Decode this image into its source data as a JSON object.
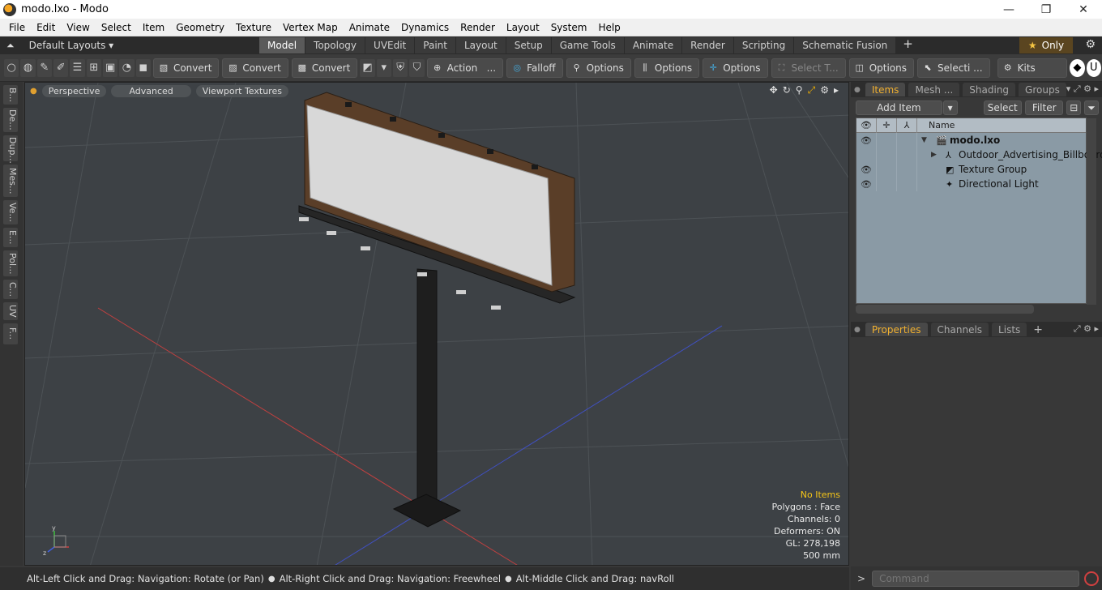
{
  "window": {
    "title": "modo.lxo - Modo",
    "minimize": "—",
    "maximize": "❐",
    "close": "✕"
  },
  "menu": [
    "File",
    "Edit",
    "View",
    "Select",
    "Item",
    "Geometry",
    "Texture",
    "Vertex Map",
    "Animate",
    "Dynamics",
    "Render",
    "Layout",
    "System",
    "Help"
  ],
  "layouts": {
    "selector": "Default Layouts ▾",
    "tabs": [
      "Model",
      "Topology",
      "UVEdit",
      "Paint",
      "Layout",
      "Setup",
      "Game Tools",
      "Animate",
      "Render",
      "Scripting",
      "Schematic Fusion"
    ],
    "active": "Model",
    "add": "+",
    "only": "Only"
  },
  "toolbar": {
    "convert1": "Convert",
    "convert2": "Convert",
    "convert3": "Convert",
    "action": "Action",
    "action_more": "...",
    "falloff": "Falloff",
    "options1": "Options",
    "options2": "Options",
    "options3": "Options",
    "select_t": "Select T...",
    "options4": "Options",
    "selecti": "Selecti ...",
    "kits": "Kits"
  },
  "left_tabs": [
    "B...",
    "De...",
    "Dup...",
    "Mes...",
    "Ve...",
    "E...",
    "Pol...",
    "C...",
    "UV",
    "F..."
  ],
  "viewport": {
    "perspective": "Perspective",
    "advanced": "Advanced",
    "textures": "Viewport Textures",
    "info": {
      "no_items": "No Items",
      "polygons": "Polygons : Face",
      "channels": "Channels: 0",
      "deformers": "Deformers: ON",
      "gl": "GL: 278,198",
      "scale": "500 mm"
    },
    "colors": {
      "background": "#3d4145",
      "grid": "#4d5256",
      "x_axis": "#c04040",
      "z_axis": "#4050c0",
      "billboard_face": "#d8d8d8",
      "frame": "#6a4a30"
    }
  },
  "status": {
    "hint1": "Alt-Left Click and Drag: Navigation: Rotate (or Pan)",
    "hint2": "Alt-Right Click and Drag: Navigation: Freewheel",
    "hint3": "Alt-Middle Click and Drag: navRoll"
  },
  "items_panel": {
    "tabs": [
      "Items",
      "Mesh ...",
      "Shading",
      "Groups"
    ],
    "active": "Items",
    "add_item": "Add Item",
    "select": "Select",
    "filter": "Filter",
    "column_name": "Name",
    "rows": [
      {
        "label": "modo.lxo",
        "eye": true
      },
      {
        "label": "Outdoor_Advertising_Billboard",
        "eye": false
      },
      {
        "label": "Texture Group",
        "eye": true
      },
      {
        "label": "Directional Light",
        "eye": true
      }
    ]
  },
  "props_panel": {
    "tabs": [
      "Properties",
      "Channels",
      "Lists"
    ],
    "active": "Properties",
    "add": "+"
  },
  "command": {
    "prompt": ">",
    "placeholder": "Command"
  }
}
